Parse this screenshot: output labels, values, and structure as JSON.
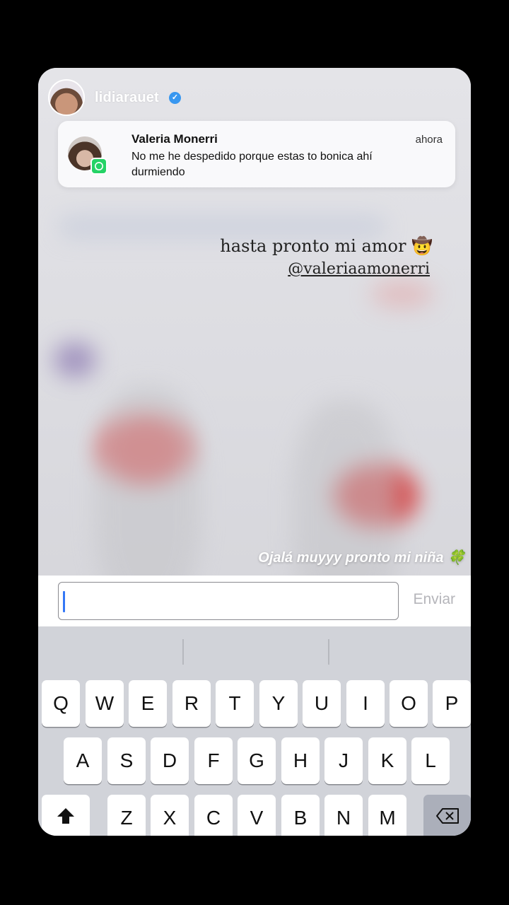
{
  "story": {
    "username": "lidiarauet",
    "verified": true,
    "caption_line1": "hasta pronto mi amor 🤠",
    "caption_mention": "@valeriaamonerri",
    "caption_bottom": "Ojalá muyyy pronto mi niña 🍀"
  },
  "notification": {
    "sender": "Valeria Monerri",
    "time": "ahora",
    "message": "No me he despedido porque estas to bonica ahí durmiendo",
    "app_icon": "whatsapp-icon"
  },
  "reply": {
    "input_value": "",
    "send_label": "Enviar"
  },
  "keyboard": {
    "row1": [
      "Q",
      "W",
      "E",
      "R",
      "T",
      "Y",
      "U",
      "I",
      "O",
      "P"
    ],
    "row2": [
      "A",
      "S",
      "D",
      "F",
      "G",
      "H",
      "J",
      "K",
      "L"
    ],
    "row3": [
      "Z",
      "X",
      "C",
      "V",
      "B",
      "N",
      "M"
    ],
    "shift_icon": "shift-icon",
    "delete_icon": "backspace-icon"
  },
  "colors": {
    "accent": "#3897f0",
    "whatsapp": "#25d366",
    "caret": "#3478f6"
  }
}
